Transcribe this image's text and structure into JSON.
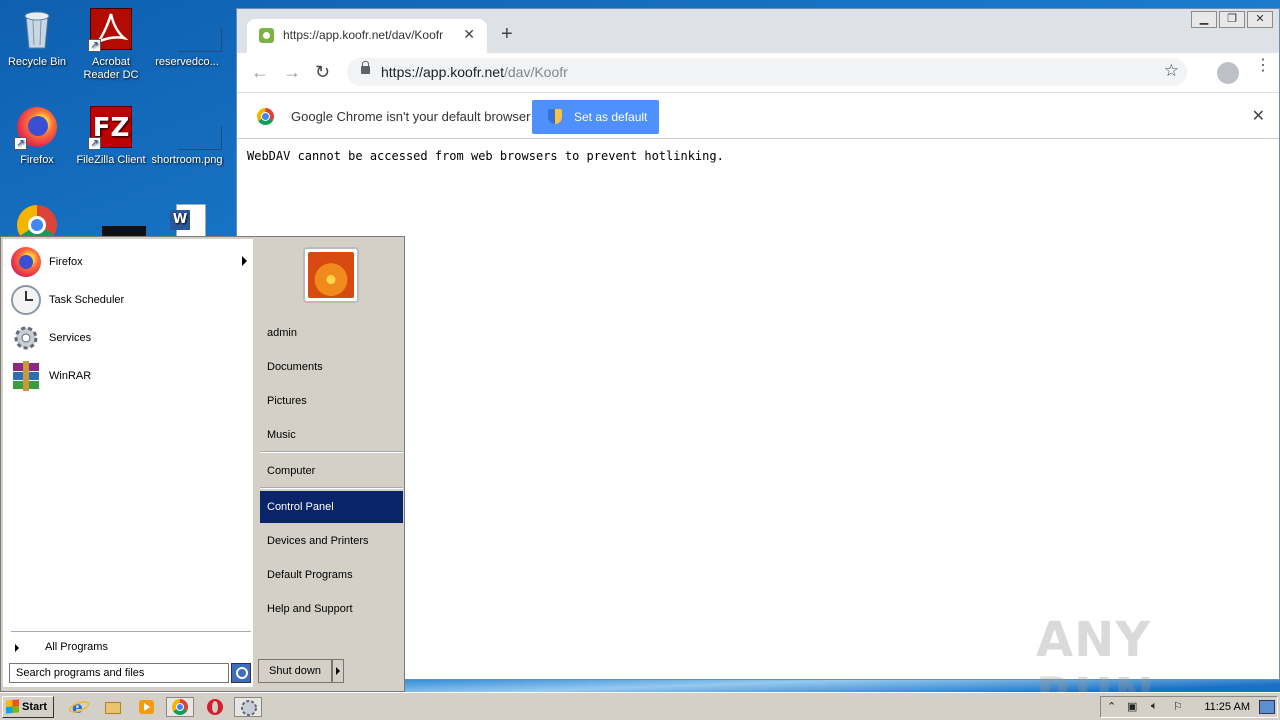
{
  "desktop": {
    "icons": [
      {
        "label": "Recycle Bin"
      },
      {
        "label": "Acrobat Reader DC"
      },
      {
        "label": "reservedco..."
      },
      {
        "label": "Firefox"
      },
      {
        "label": "FileZilla Client"
      },
      {
        "label": "shortroom.png"
      }
    ]
  },
  "browser": {
    "tab_title": "https://app.koofr.net/dav/Koofr",
    "url_host": "https://app.koofr.net",
    "url_path": "/dav/Koofr",
    "infobar_message": "Google Chrome isn't your default browser",
    "infobar_button": "Set as default",
    "page_text": "WebDAV cannot be accessed from web browsers to prevent hotlinking."
  },
  "start_menu": {
    "programs": [
      {
        "label": "Firefox"
      },
      {
        "label": "Task Scheduler"
      },
      {
        "label": "Services"
      },
      {
        "label": "WinRAR"
      }
    ],
    "all_programs": "All Programs",
    "search_placeholder": "Search programs and files",
    "right_items": [
      {
        "label": "admin"
      },
      {
        "label": "Documents"
      },
      {
        "label": "Pictures"
      },
      {
        "label": "Music"
      },
      {
        "label": "Computer"
      },
      {
        "label": "Control Panel"
      },
      {
        "label": "Devices and Printers"
      },
      {
        "label": "Default Programs"
      },
      {
        "label": "Help and Support"
      }
    ],
    "shutdown": "Shut down"
  },
  "taskbar": {
    "start": "Start",
    "clock": "11:25 AM"
  },
  "watermark": "ANY RUN"
}
